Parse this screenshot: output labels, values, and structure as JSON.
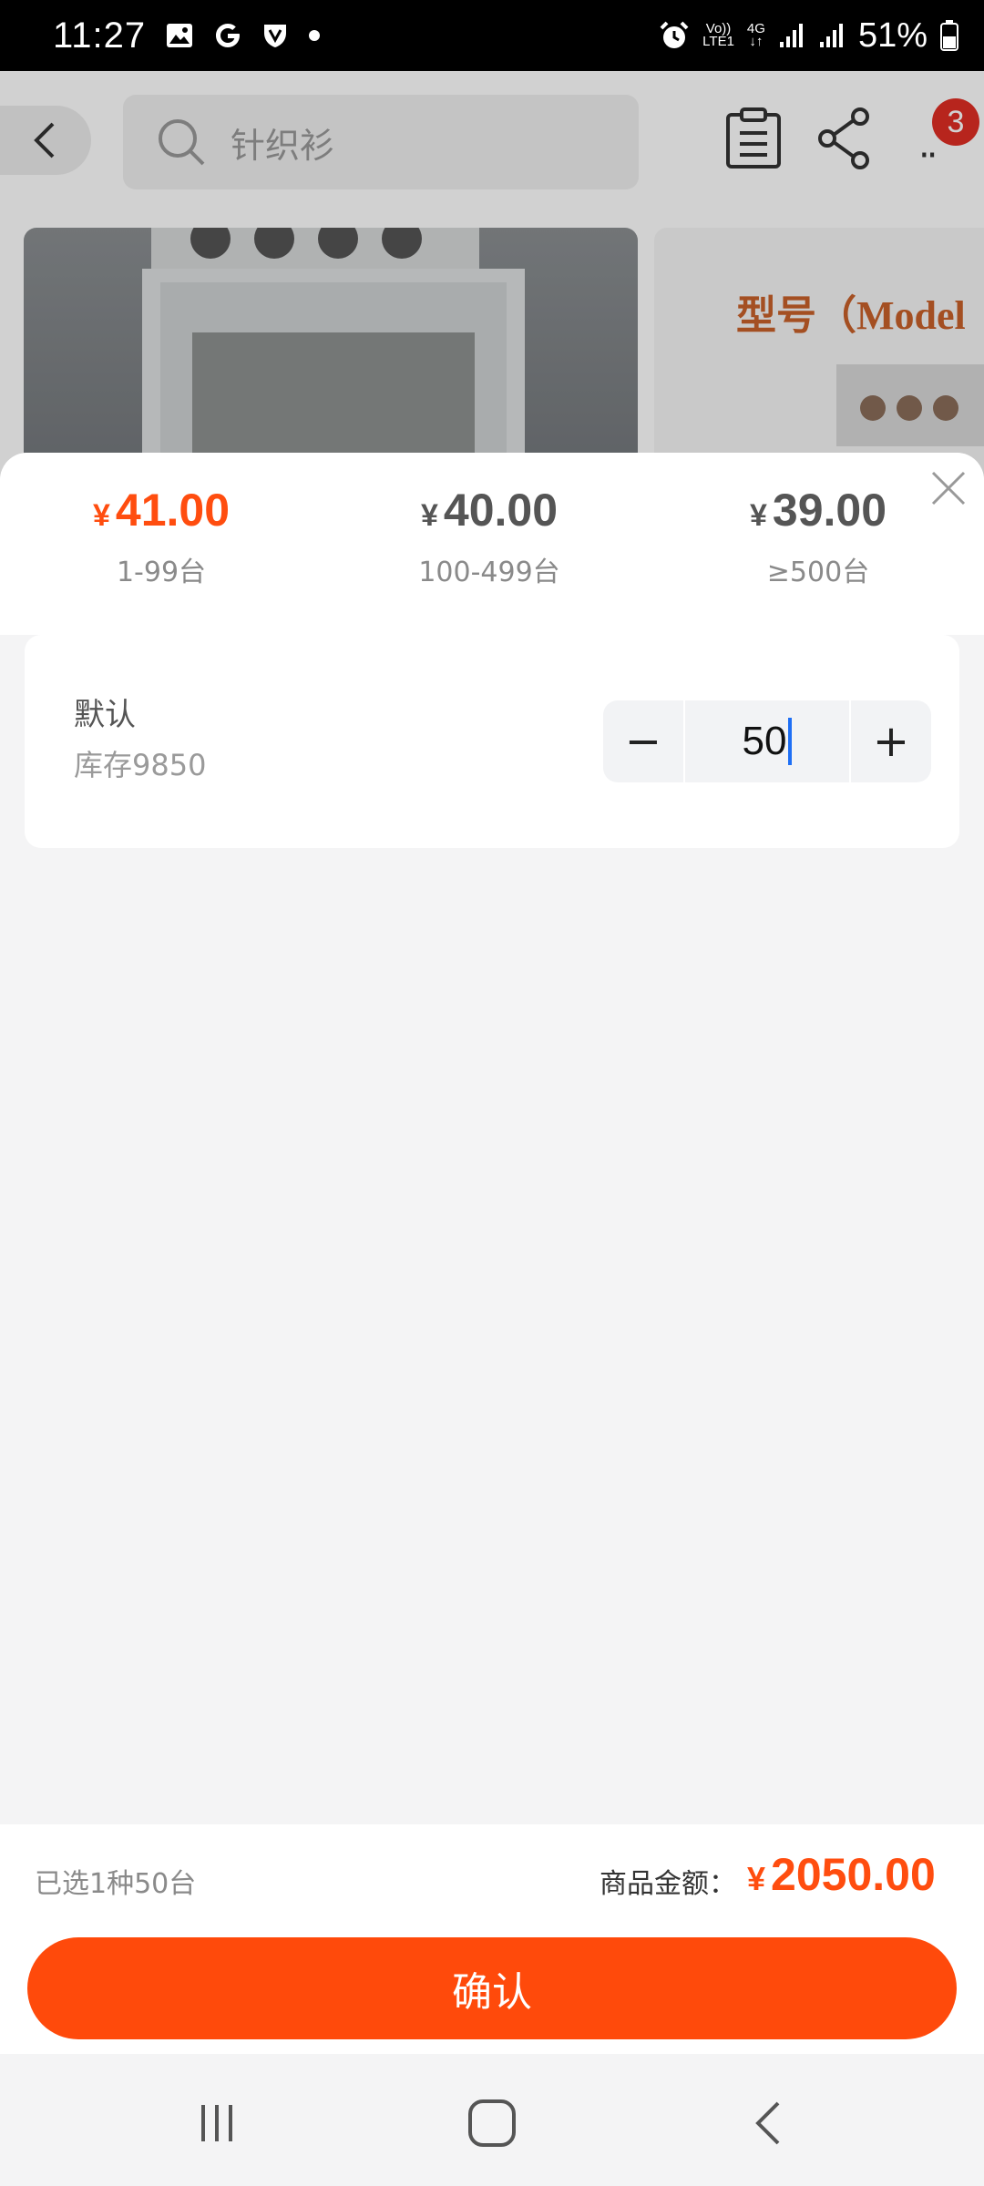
{
  "status_bar": {
    "time": "11:27",
    "battery": "51%",
    "net_top": "Vo))",
    "net_bottom": "LTE1",
    "data_type": "4G",
    "icons": [
      "image-icon",
      "google-icon",
      "vpn-shield-icon",
      "dot-icon",
      "alarm-icon",
      "signal-icon",
      "signal-icon",
      "battery-icon"
    ]
  },
  "header": {
    "search_placeholder": "针织衫",
    "cart_badge": "3",
    "icons": [
      "back-icon",
      "search-icon",
      "clipboard-icon",
      "share-icon",
      "more-icon"
    ]
  },
  "gallery": {
    "image2_title": "型号（Model"
  },
  "price_tiers": [
    {
      "currency": "¥",
      "price": "41.00",
      "range": "1-99台",
      "active": true
    },
    {
      "currency": "¥",
      "price": "40.00",
      "range": "100-499台",
      "active": false
    },
    {
      "currency": "¥",
      "price": "39.00",
      "range": "≥500台",
      "active": false
    }
  ],
  "sku": {
    "name": "默认",
    "stock": "库存9850",
    "minus_label": "−",
    "plus_label": "+",
    "quantity": "50"
  },
  "footer": {
    "selected_text": "已选1种50台",
    "total_label": "商品金额：",
    "total_currency": "¥",
    "total_amount": "2050.00",
    "confirm_label": "确认"
  },
  "colors": {
    "accent": "#ff4a0b",
    "price_active": "#ff4d0f",
    "price_inactive": "#555555"
  }
}
